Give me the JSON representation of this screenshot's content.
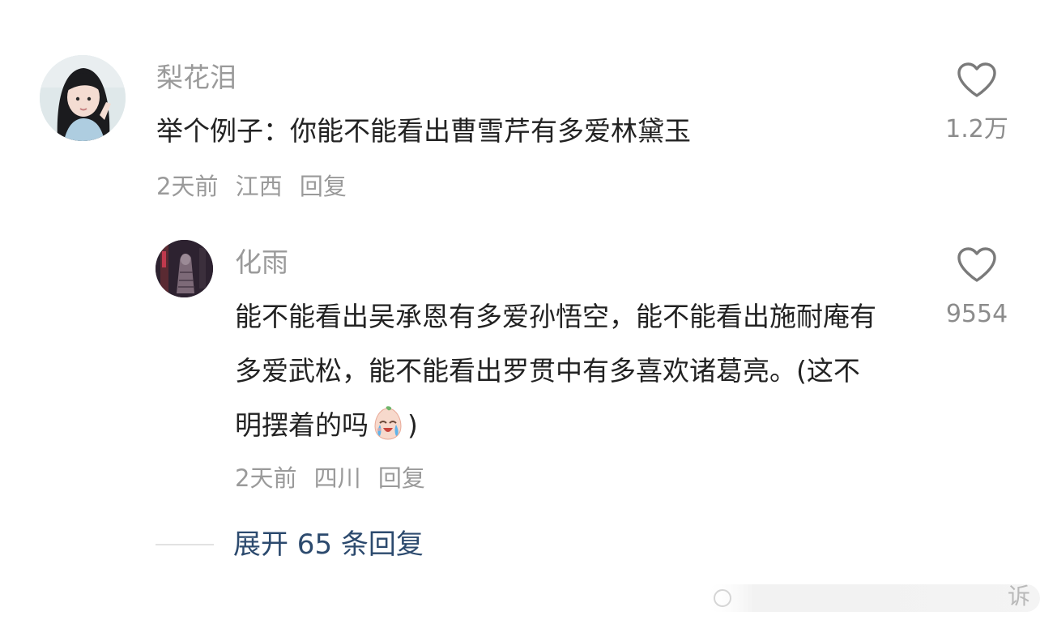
{
  "main_comment": {
    "username": "梨花泪",
    "text": "举个例子：你能不能看出曹雪芹有多爱林黛玉",
    "time": "2天前",
    "location": "江西",
    "reply_label": "回复",
    "like_count": "1.2万",
    "like_icon": "heart-outline-icon",
    "avatar_icon": "user-avatar-photo"
  },
  "reply_comment": {
    "username": "化雨",
    "text_before_emoji": "能不能看出吴承恩有多爱孙悟空，能不能看出施耐庵有多爱武松，能不能看出罗贯中有多喜欢诸葛亮。(这不明摆着的吗",
    "text_after_emoji": ")",
    "emoji": "crying-face-emoji-icon",
    "time": "2天前",
    "location": "四川",
    "reply_label": "回复",
    "like_count": "9554",
    "like_icon": "heart-outline-icon",
    "avatar_icon": "dark-art-avatar"
  },
  "expand_replies": {
    "label": "展开 65 条回复",
    "accent_color": "#2c4a6e"
  },
  "watermark": {
    "text": "诉"
  },
  "colors": {
    "username": "#9a9a9a",
    "text": "#222222",
    "meta": "#9a9a9a",
    "link": "#2c4a6e"
  }
}
